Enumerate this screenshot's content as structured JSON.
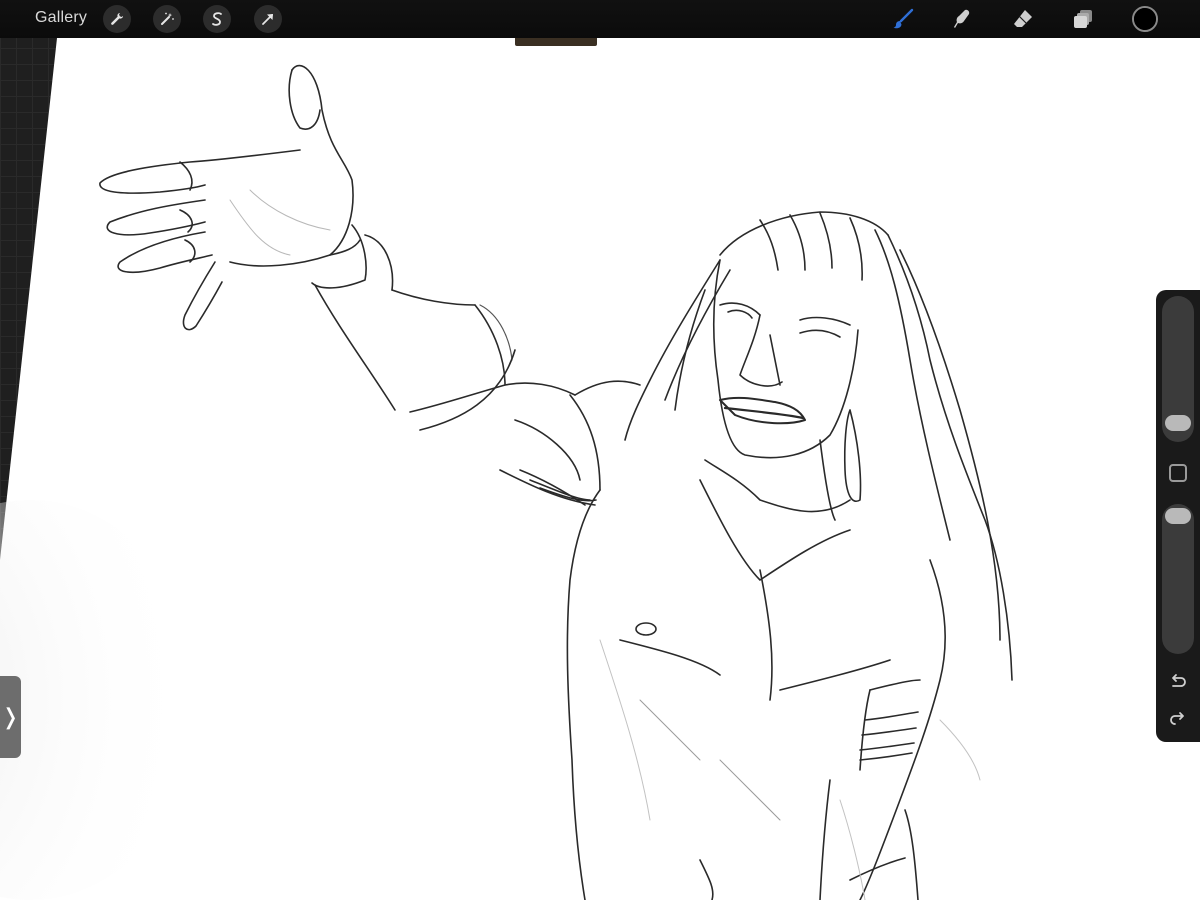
{
  "topbar": {
    "gallery_label": "Gallery",
    "left_tools": [
      {
        "name": "actions",
        "icon": "wrench-icon"
      },
      {
        "name": "adjustments",
        "icon": "magic-wand-icon"
      },
      {
        "name": "selection",
        "icon": "selection-s-icon"
      },
      {
        "name": "transform",
        "icon": "arrow-cursor-icon"
      }
    ],
    "right_tools": [
      {
        "name": "brush",
        "icon": "brush-icon",
        "active": true
      },
      {
        "name": "smudge",
        "icon": "smudge-icon",
        "active": false
      },
      {
        "name": "eraser",
        "icon": "eraser-icon",
        "active": false
      },
      {
        "name": "layers",
        "icon": "layers-icon",
        "active": false
      }
    ],
    "current_color": "#000000",
    "active_color": "#2f6fd6"
  },
  "sidebar": {
    "brush_size_level": 0.82,
    "opacity_level": 0.08,
    "undo_icon": "undo-icon",
    "redo_icon": "redo-icon",
    "modify_icon": "square-icon"
  },
  "left_panel": {
    "toggle_glyph": "❭"
  },
  "colors": {
    "toolbar_bg": "#0b0b0b",
    "canvas_bg": "#ffffff",
    "stroke": "#2a2a2a"
  }
}
